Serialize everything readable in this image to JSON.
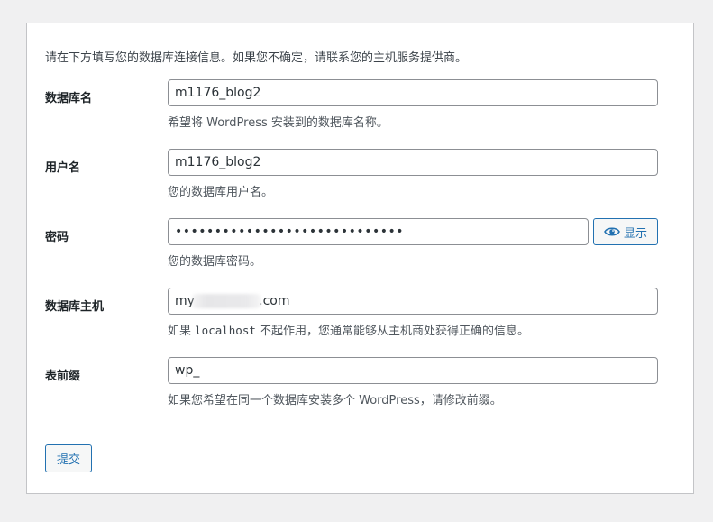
{
  "intro": "请在下方填写您的数据库连接信息。如果您不确定，请联系您的主机服务提供商。",
  "fields": {
    "dbname": {
      "label": "数据库名",
      "value": "m1176_blog2",
      "desc": "希望将 WordPress 安装到的数据库名称。"
    },
    "uname": {
      "label": "用户名",
      "value": "m1176_blog2",
      "desc": "您的数据库用户名。"
    },
    "pwd": {
      "label": "密码",
      "value": "•••••••••••••••••••••••••••••",
      "toggle_label": "显示",
      "toggle_icon": "eye-icon",
      "desc": "您的数据库密码。"
    },
    "dbhost": {
      "label": "数据库主机",
      "value": "my                .com",
      "desc_before": "如果 ",
      "desc_code": "localhost",
      "desc_after": " 不起作用，您通常能够从主机商处获得正确的信息。"
    },
    "prefix": {
      "label": "表前缀",
      "value": "wp_",
      "desc": "如果您希望在同一个数据库安装多个 WordPress，请修改前缀。"
    }
  },
  "submit_label": "提交",
  "colors": {
    "accent": "#2271b1",
    "text": "#3c434a",
    "border": "#8c8f94",
    "background": "#f0f0f1"
  }
}
